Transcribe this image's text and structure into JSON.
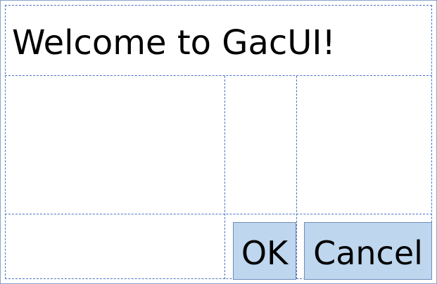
{
  "window": {
    "title_text": "Welcome to GacUI!"
  },
  "buttons": {
    "ok_label": "OK",
    "cancel_label": "Cancel"
  },
  "colors": {
    "grid_line": "#4a73c4",
    "button_fill": "#bed6ee",
    "button_border": "#6f8db8",
    "window_border": "#8aa3c8"
  }
}
